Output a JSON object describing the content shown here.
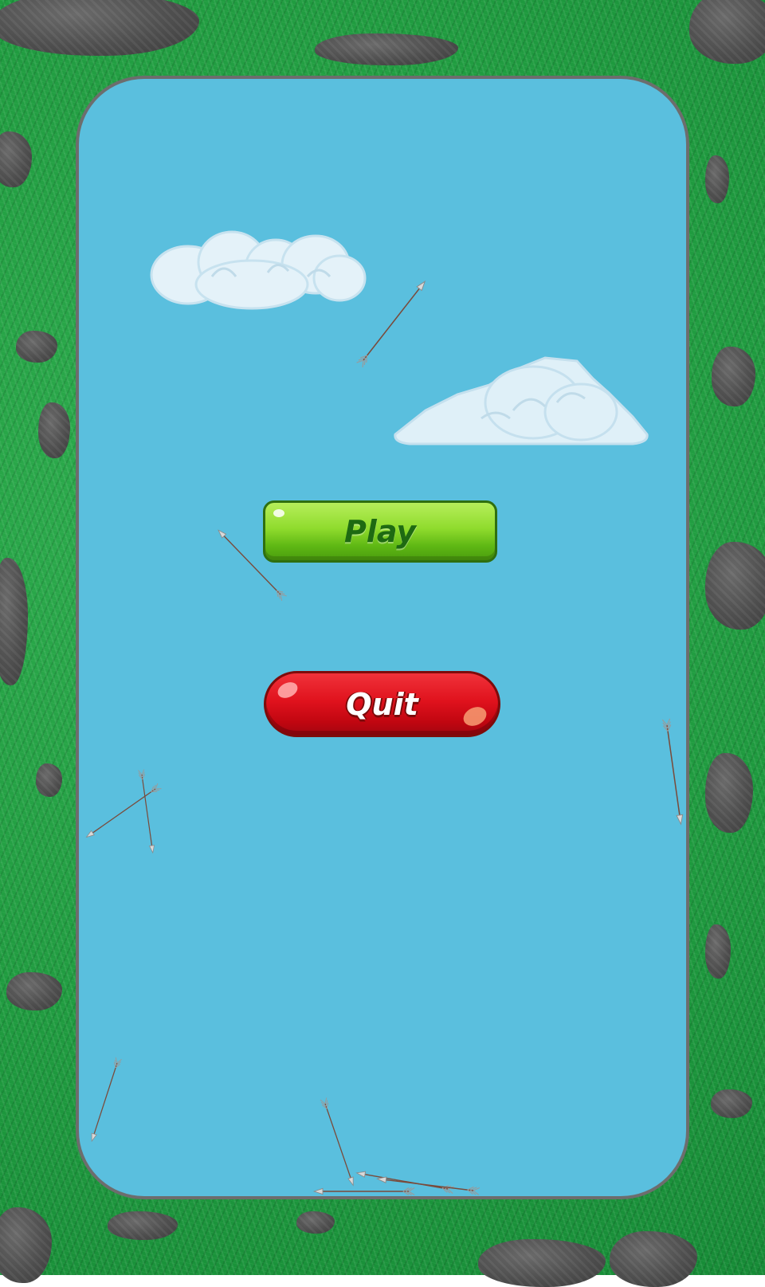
{
  "menu": {
    "play_label": "Play",
    "quit_label": "Quit"
  },
  "colors": {
    "sky": "#5abfde",
    "grass": "#1f9a3f",
    "rock": "#4e4e4e",
    "frame_border": "#6d6d6d",
    "play_button": "#8fdb2d",
    "play_text": "#1e6a12",
    "quit_button": "#e0121d",
    "quit_text": "#ffffff",
    "cloud": "#dff0f8",
    "arrow_shaft": "#7a4a3a"
  },
  "icons": {
    "clouds": [
      "cloud-icon",
      "cloud-icon"
    ],
    "arrows": "arrow-icon"
  }
}
